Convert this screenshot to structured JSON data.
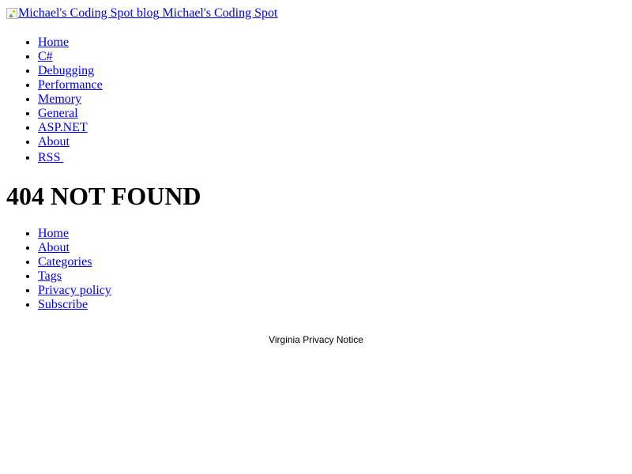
{
  "header": {
    "logo_alt": "Michael's Coding Spot blog",
    "site_name": "Michael's Coding Spot"
  },
  "top_nav": {
    "items": [
      {
        "label": "Home"
      },
      {
        "label": "C#"
      },
      {
        "label": "Debugging"
      },
      {
        "label": "Performance"
      },
      {
        "label": "Memory"
      },
      {
        "label": "General"
      },
      {
        "label": "ASP.NET"
      },
      {
        "label": "About"
      },
      {
        "label": "RSS "
      }
    ]
  },
  "main": {
    "title": "404 NOT FOUND"
  },
  "footer_nav": {
    "items": [
      {
        "label": "Home"
      },
      {
        "label": "About"
      },
      {
        "label": "Categories"
      },
      {
        "label": "Tags"
      },
      {
        "label": "Privacy policy"
      },
      {
        "label": "Subscribe"
      }
    ]
  },
  "notice": {
    "label": "Virginia Privacy Notice"
  }
}
